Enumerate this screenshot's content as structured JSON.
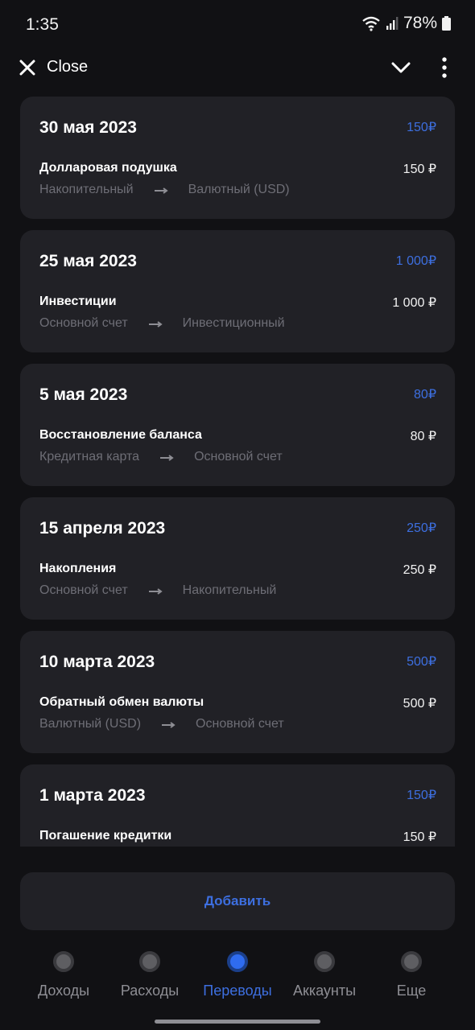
{
  "status_bar": {
    "time": "1:35",
    "battery": "78%",
    "icons": [
      "wifi-icon",
      "signal-icon",
      "battery-icon"
    ]
  },
  "app_bar": {
    "close_label": "Close",
    "icons": [
      "close-icon",
      "chevron-down-icon",
      "more-vertical-icon"
    ]
  },
  "transfers": [
    {
      "date": "30 мая 2023",
      "total": "150₽",
      "name": "Долларовая подушка",
      "amount": "150 ₽",
      "from": "Накопительный",
      "to": "Валютный (USD)"
    },
    {
      "date": "25 мая 2023",
      "total": "1 000₽",
      "name": "Инвестиции",
      "amount": "1 000 ₽",
      "from": "Основной счет",
      "to": "Инвестиционный"
    },
    {
      "date": "5 мая 2023",
      "total": "80₽",
      "name": "Восстановление баланса",
      "amount": "80 ₽",
      "from": "Кредитная карта",
      "to": "Основной счет"
    },
    {
      "date": "15 апреля 2023",
      "total": "250₽",
      "name": "Накопления",
      "amount": "250 ₽",
      "from": "Основной счет",
      "to": "Накопительный"
    },
    {
      "date": "10 марта 2023",
      "total": "500₽",
      "name": "Обратный обмен валюты",
      "amount": "500 ₽",
      "from": "Валютный (USD)",
      "to": "Основной счет"
    },
    {
      "date": "1 марта 2023",
      "total": "150₽",
      "name": "Погашение кредитки",
      "amount": "150 ₽",
      "from": "",
      "to": ""
    }
  ],
  "add_button": {
    "label": "Добавить"
  },
  "bottom_nav": [
    {
      "label": "Доходы",
      "active": false
    },
    {
      "label": "Расходы",
      "active": false
    },
    {
      "label": "Переводы",
      "active": true
    },
    {
      "label": "Аккаунты",
      "active": false
    },
    {
      "label": "Еще",
      "active": false
    }
  ],
  "colors": {
    "background": "#111114",
    "card": "#212126",
    "accent": "#3d6fe0",
    "muted_text": "#6e6e76"
  }
}
